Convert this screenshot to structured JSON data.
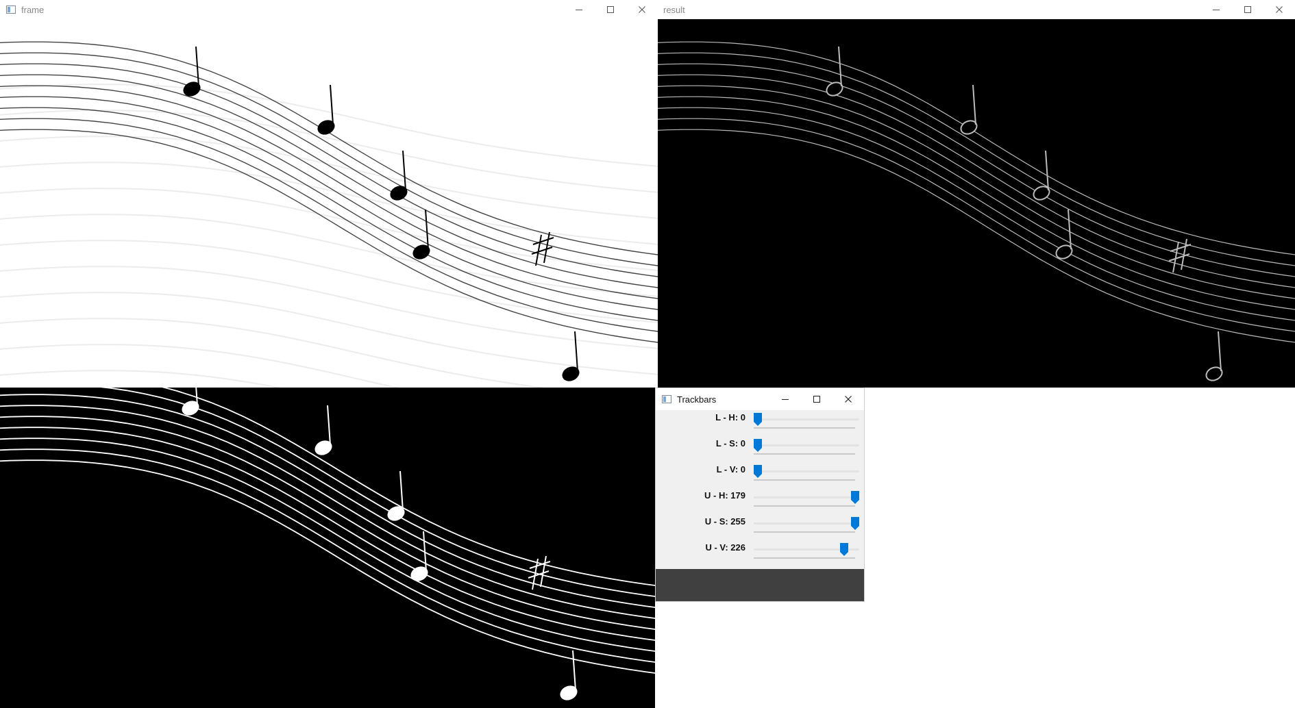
{
  "windows": {
    "frame": {
      "title": "frame"
    },
    "result": {
      "title": "result"
    },
    "mask": {
      "title": ""
    },
    "trackbars": {
      "title": "Trackbars"
    }
  },
  "trackbars": [
    {
      "label": "L - H: 0",
      "name": "L - H",
      "value": 0,
      "max": 179
    },
    {
      "label": "L - S: 0",
      "name": "L - S",
      "value": 0,
      "max": 255
    },
    {
      "label": "L - V: 0",
      "name": "L - V",
      "value": 0,
      "max": 255
    },
    {
      "label": "U - H: 179",
      "name": "U - H",
      "value": 179,
      "max": 179
    },
    {
      "label": "U - S: 255",
      "name": "U - S",
      "value": 255,
      "max": 255
    },
    {
      "label": "U - V: 226",
      "name": "U - V",
      "value": 226,
      "max": 255
    }
  ],
  "colors": {
    "slider_accent": "#0078d7",
    "mask_bg": "#000000",
    "footer": "#404040"
  },
  "icons": [
    "window-app-icon",
    "minimize-icon",
    "maximize-icon",
    "close-icon",
    "slider-thumb-icon"
  ]
}
